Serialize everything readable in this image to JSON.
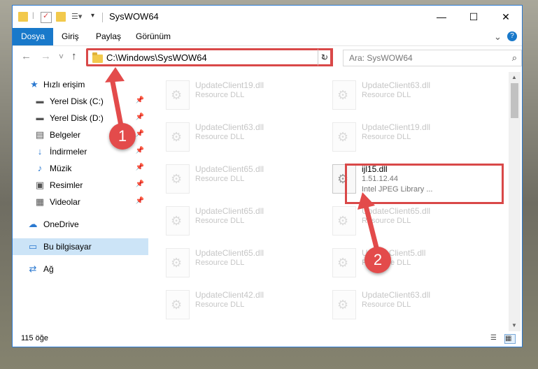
{
  "window": {
    "title": "SysWOW64",
    "controls": {
      "minimize": "—",
      "maximize": "☐",
      "close": "✕"
    }
  },
  "ribbon": {
    "tabs": [
      "Dosya",
      "Giriş",
      "Paylaş",
      "Görünüm"
    ],
    "expand": "⌄",
    "help": "?"
  },
  "navigation": {
    "back": "←",
    "forward": "→",
    "recent": "˅",
    "up": "↑",
    "address": "C:\\Windows\\SysWOW64",
    "dropdown": "⌄",
    "refresh": "↻",
    "search_placeholder": "Ara: SysWOW64",
    "search_icon": "⌕"
  },
  "sidebar": {
    "quick_access": "Hızlı erişim",
    "items": [
      {
        "label": "Yerel Disk (C:)",
        "icon": "drive-icon"
      },
      {
        "label": "Yerel Disk (D:)",
        "icon": "drive-icon"
      },
      {
        "label": "Belgeler",
        "icon": "documents-icon"
      },
      {
        "label": "İndirmeler",
        "icon": "download-icon"
      },
      {
        "label": "Müzik",
        "icon": "music-icon"
      },
      {
        "label": "Resimler",
        "icon": "pictures-icon"
      },
      {
        "label": "Videolar",
        "icon": "videos-icon"
      }
    ],
    "onedrive": "OneDrive",
    "this_pc": "Bu bilgisayar",
    "network": "Ağ"
  },
  "files": {
    "left": [
      {
        "name": "UpdateClient19.dll",
        "type": "Resource DLL"
      },
      {
        "name": "UpdateClient63.dll",
        "type": "Resource DLL"
      },
      {
        "name": "UpdateClient65.dll",
        "type": "Resource DLL"
      },
      {
        "name": "UpdateClient65.dll",
        "type": "Resource DLL"
      },
      {
        "name": "UpdateClient65.dll",
        "type": "Resource DLL"
      },
      {
        "name": "UpdateClient42.dll",
        "type": "Resource DLL"
      }
    ],
    "right": [
      {
        "name": "UpdateClient63.dll",
        "type": "Resource DLL"
      },
      {
        "name": "UpdateClient19.dll",
        "type": "Resource DLL"
      },
      {
        "name": "ijl15.dll",
        "version": "1.51.12.44",
        "type": "Intel JPEG Library ..."
      },
      {
        "name": "UpdateClient65.dll",
        "type": "Resource DLL"
      },
      {
        "name": "UpdateClient5.dll",
        "type": "Resource DLL"
      },
      {
        "name": "UpdateClient63.dll",
        "type": "Resource DLL"
      }
    ]
  },
  "status": {
    "count": "115 öğe"
  },
  "annotations": {
    "step1": "1",
    "step2": "2",
    "color": "#e34b4b"
  }
}
